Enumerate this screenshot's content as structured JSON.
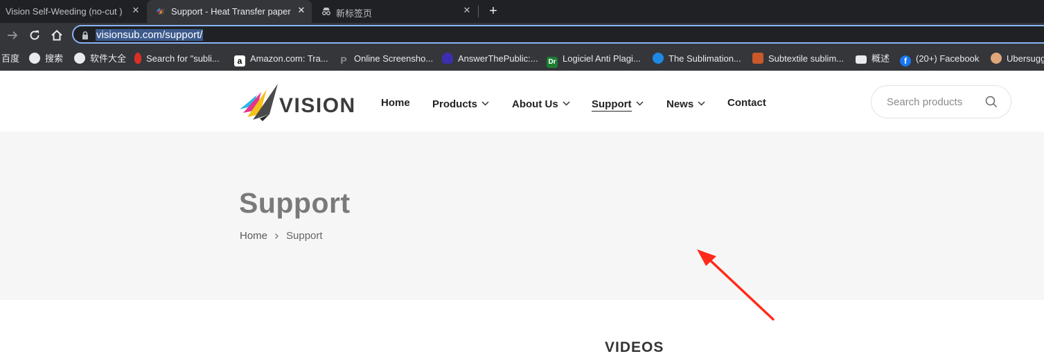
{
  "browser": {
    "tabs": [
      {
        "title": "Vision Self-Weeding (no-cut )",
        "active": false
      },
      {
        "title": "Support - Heat Transfer paper",
        "active": true
      },
      {
        "title": "新标签页",
        "active": false
      }
    ],
    "new_tab": "+",
    "url": "visionsub.com/support/",
    "bookmarks": [
      {
        "label": "百度",
        "icon": "baidu-icon"
      },
      {
        "label": "搜索",
        "icon": "globe-icon"
      },
      {
        "label": "软件大全",
        "icon": "globe-icon"
      },
      {
        "label": "Search for \"subli...",
        "icon": "flame-icon"
      },
      {
        "label": "Amazon.com: Tra...",
        "icon": "amazon-icon"
      },
      {
        "label": "Online Screensho...",
        "icon": "p-icon"
      },
      {
        "label": "AnswerThePublic:...",
        "icon": "hand-icon"
      },
      {
        "label": "Logiciel Anti Plagi...",
        "icon": "dr-icon"
      },
      {
        "label": "The Sublimation...",
        "icon": "blue-circle-icon"
      },
      {
        "label": "Subtextile sublim...",
        "icon": "s-icon"
      },
      {
        "label": "概述",
        "icon": "store-icon"
      },
      {
        "label": "(20+) Facebook",
        "icon": "facebook-icon"
      },
      {
        "label": "Ubersugg",
        "icon": "face-icon"
      }
    ]
  },
  "site": {
    "brand": "VISION",
    "nav": [
      {
        "label": "Home",
        "dropdown": false
      },
      {
        "label": "Products",
        "dropdown": true
      },
      {
        "label": "About Us",
        "dropdown": true
      },
      {
        "label": "Support",
        "dropdown": true,
        "current": true
      },
      {
        "label": "News",
        "dropdown": true
      },
      {
        "label": "Contact",
        "dropdown": false
      }
    ],
    "search_placeholder": "Search products",
    "page_title": "Support",
    "breadcrumb": {
      "home": "Home",
      "current": "Support"
    },
    "section_title": "VIDEOS"
  },
  "colors": {
    "annotation_arrow": "#ff2a1a",
    "hero_bg": "#f6f6f6",
    "url_focus": "#8ab4f8"
  }
}
